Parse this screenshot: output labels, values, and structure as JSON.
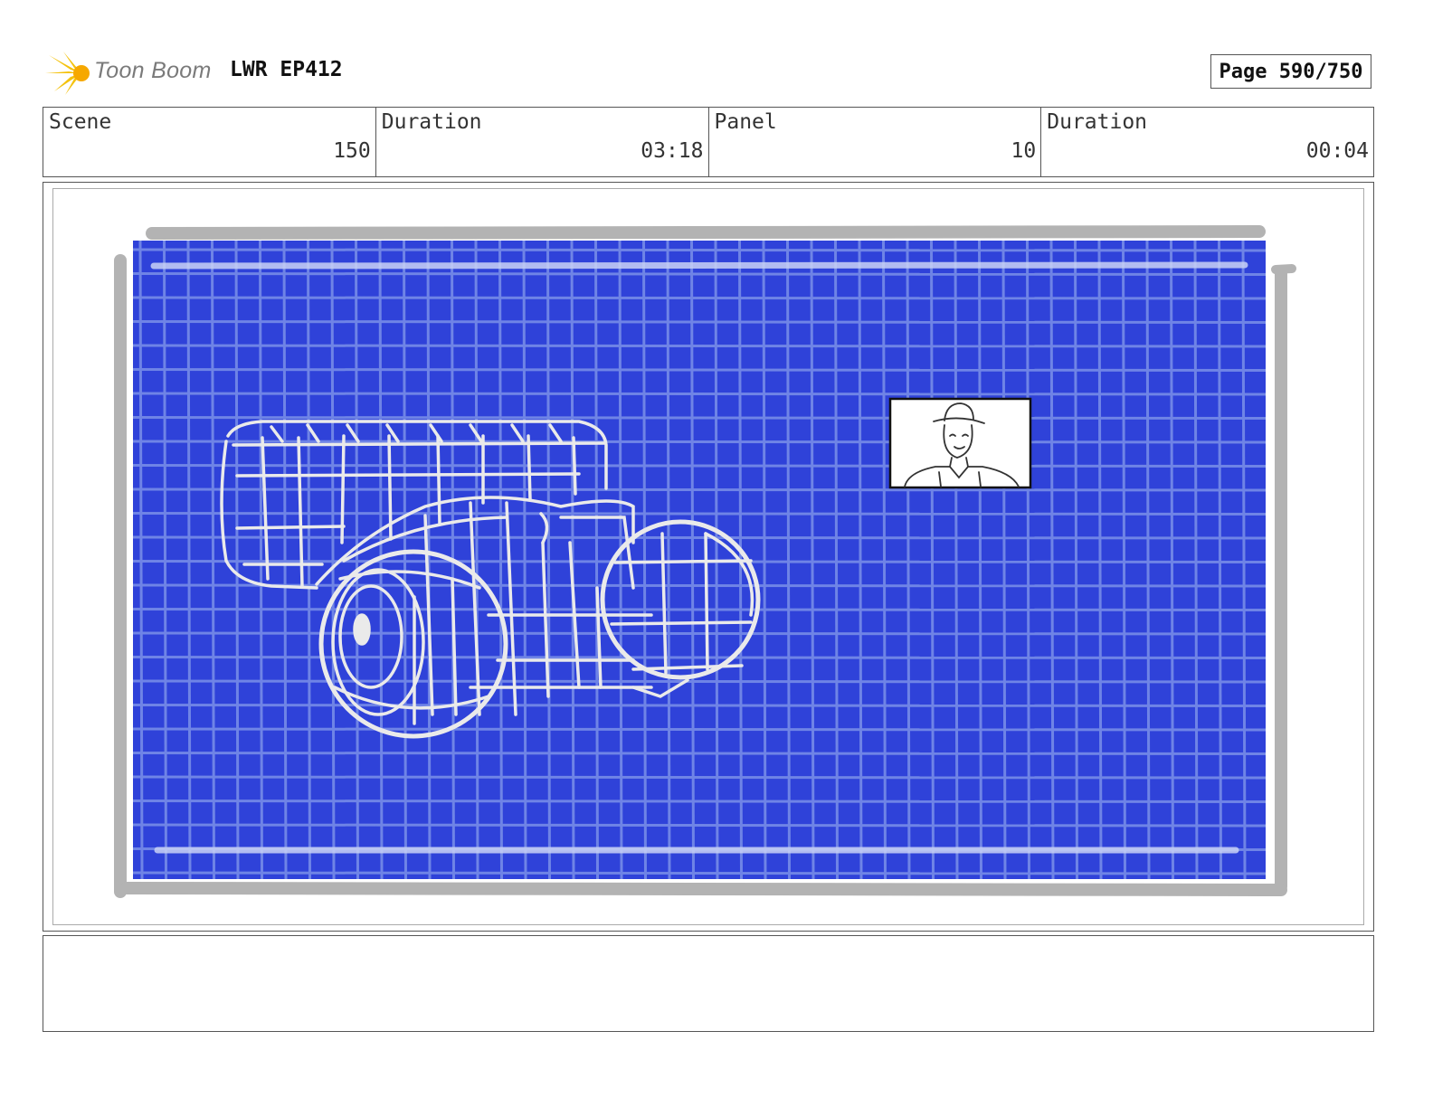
{
  "header": {
    "logo_text": "Toon Boom",
    "title": "LWR EP412",
    "page": "Page 590/750"
  },
  "info": [
    {
      "label": "Scene",
      "value": "150"
    },
    {
      "label": "Duration",
      "value": "03:18"
    },
    {
      "label": "Panel",
      "value": "10"
    },
    {
      "label": "Duration",
      "value": "00:04"
    }
  ],
  "panel": {
    "screen_color": "#2f42d9",
    "grid_color": "#6f84e6",
    "frame_color": "#b3b3b3",
    "sketch_color": "#eaeaea"
  },
  "caption": {
    "text": ""
  }
}
